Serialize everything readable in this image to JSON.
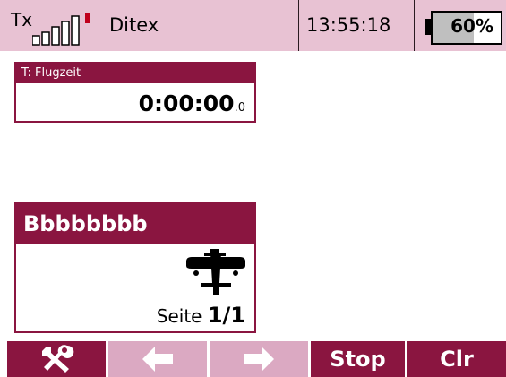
{
  "topbar": {
    "tx_label": "Tx",
    "title": "Ditex",
    "time": "13:55:18",
    "battery": {
      "percent_label": "60%",
      "level": 0.6
    },
    "signal_icon": "signal-strength-icon"
  },
  "timer": {
    "label": "T: Flugzeit",
    "value": "0:00:00",
    "fraction": ".0"
  },
  "model": {
    "name": "Bbbbbbbb",
    "icon": "airplane-icon",
    "page_label": "Seite",
    "page_value": "1/1"
  },
  "softkeys": {
    "tools_icon": "tools-icon",
    "left_icon": "arrow-left-icon",
    "right_icon": "arrow-right-icon",
    "stop_label": "Stop",
    "clr_label": "Clr"
  },
  "colors": {
    "header_bg": "#e8c2d3",
    "accent": "#8a1540",
    "accent_disabled": "#dba9c2"
  }
}
